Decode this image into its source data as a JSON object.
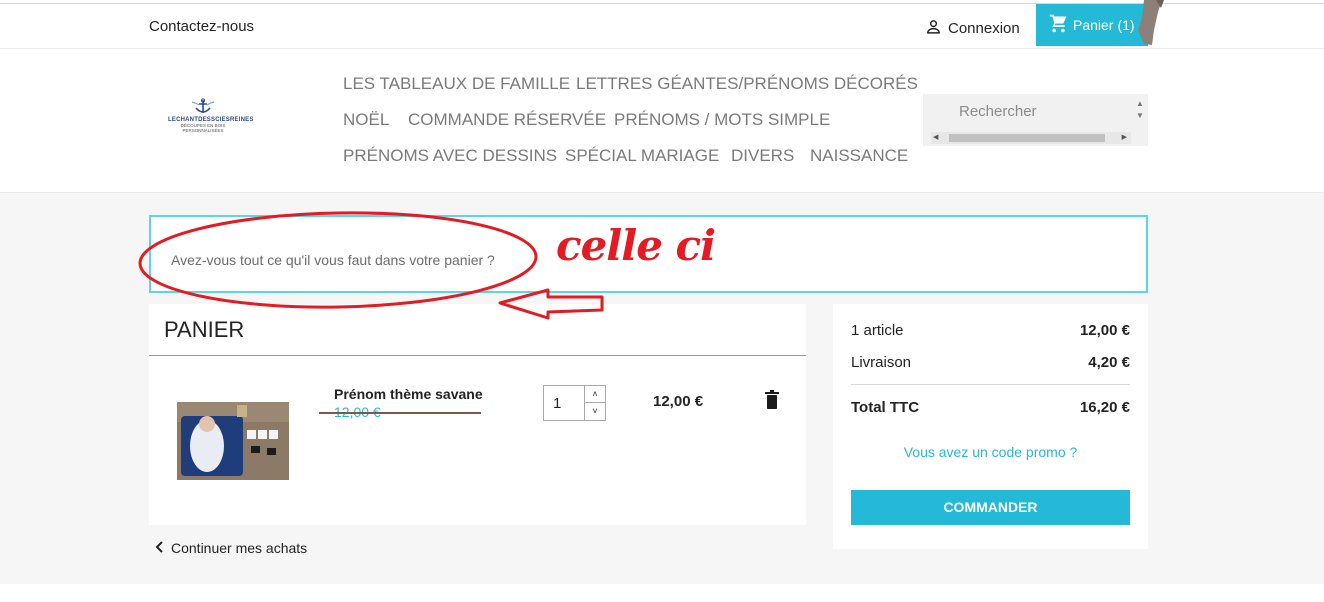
{
  "topbar": {
    "contact_label": "Contactez-nous",
    "login_label": "Connexion",
    "cart_label": "Panier",
    "cart_count": "(1)"
  },
  "logo": {
    "name": "LECHANTDESSCIESREINES",
    "tagline": "DÉCOUPES EN BOIS PERSONNALISÉES"
  },
  "nav": {
    "items": [
      "LES TABLEAUX DE FAMILLE",
      "LETTRES GÉANTES/PRÉNOMS DÉCORÉS",
      "NOËL",
      "COMMANDE RÉSERVÉE",
      "PRÉNOMS / MOTS SIMPLE",
      "PRÉNOMS AVEC DESSINS",
      "SPÉCIAL MARIAGE",
      "DIVERS",
      "NAISSANCE"
    ]
  },
  "search": {
    "placeholder": "Rechercher"
  },
  "notice": {
    "text": "Avez-vous tout ce qu'il vous faut dans votre panier ?"
  },
  "annotation": {
    "text": "celle ci",
    "color": "#e31b23"
  },
  "cart": {
    "title": "PANIER",
    "item": {
      "name": "Prénom thème savane",
      "old_price": "12,00 €",
      "quantity": "1",
      "price": "12,00 €"
    },
    "continue_label": "Continuer mes achats"
  },
  "summary": {
    "articles_label": "1 article",
    "articles_value": "12,00 €",
    "shipping_label": "Livraison",
    "shipping_value": "4,20 €",
    "total_label": "Total TTC",
    "total_value": "16,20 €",
    "promo_label": "Vous avez un code promo ?",
    "order_label": "COMMANDER"
  },
  "colors": {
    "accent": "#24b9d7",
    "notice_border": "#5fd3ea",
    "annotation": "#e31b23"
  }
}
